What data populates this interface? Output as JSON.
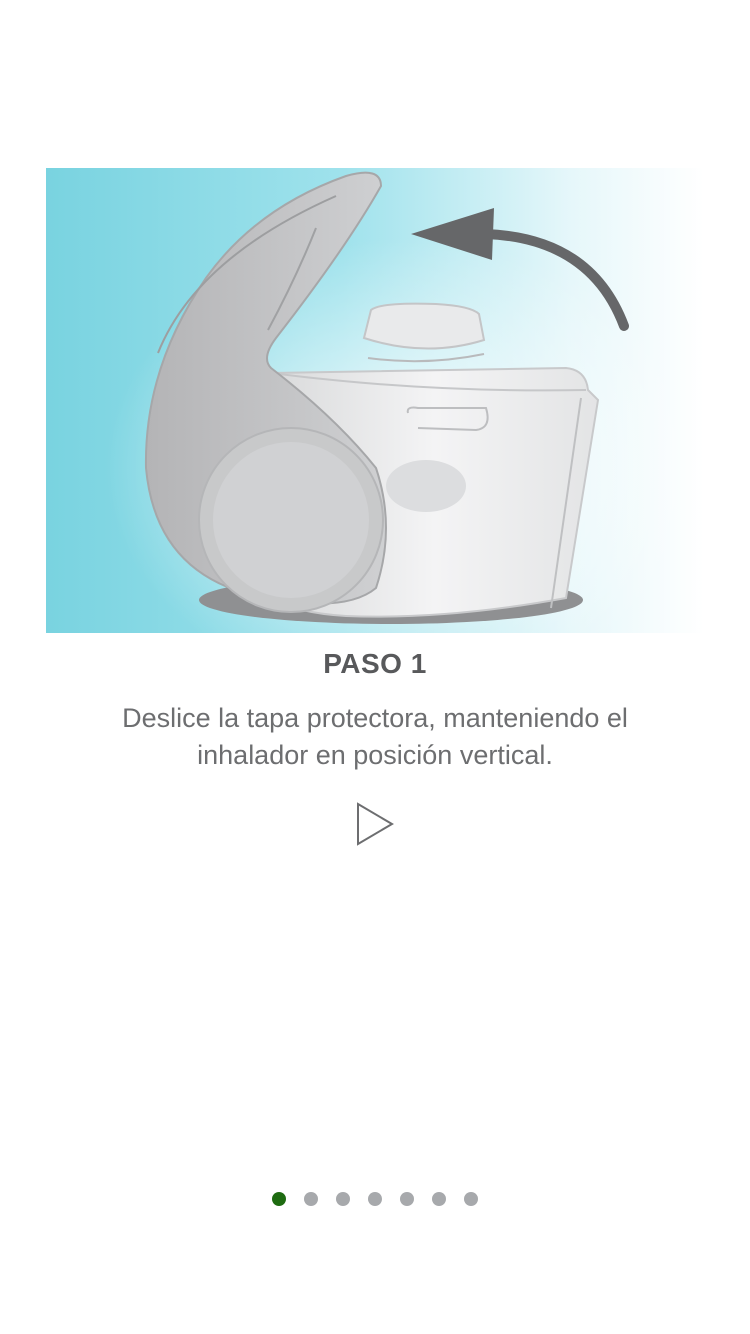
{
  "step": {
    "title": "PASO 1",
    "description": "Deslice la tapa protectora, manteniendo el inhalador en posición vertical."
  },
  "illustration": {
    "icon": "inhaler-open-cap-illustration"
  },
  "controls": {
    "play_icon": "play-icon"
  },
  "pager": {
    "total": 7,
    "active_index": 0
  },
  "colors": {
    "active_dot": "#1e6b11",
    "inactive_dot": "#a7a9ac",
    "background_teal": "#79d3e0"
  }
}
